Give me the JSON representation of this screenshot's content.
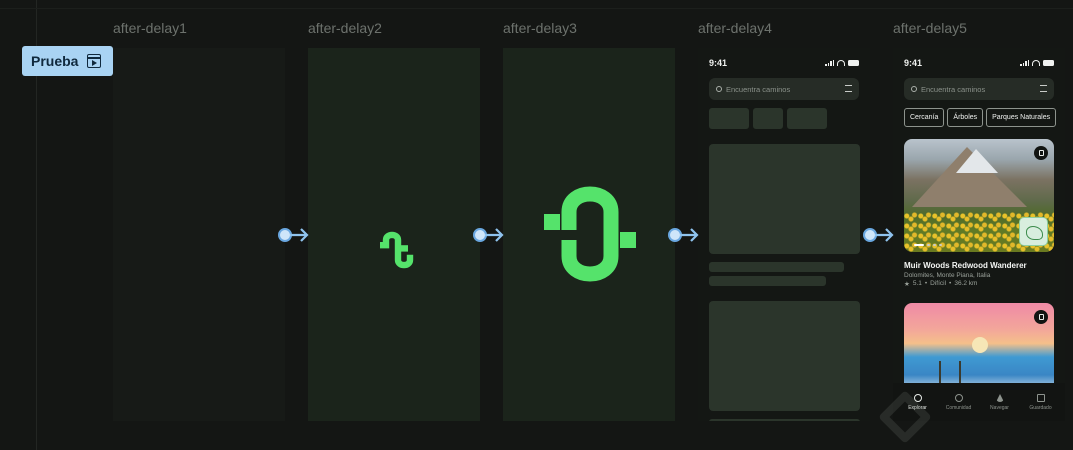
{
  "flow": {
    "name": "Prueba"
  },
  "frames": [
    {
      "label": "after-delay1"
    },
    {
      "label": "after-delay2"
    },
    {
      "label": "after-delay3"
    },
    {
      "label": "after-delay4"
    },
    {
      "label": "after-delay5"
    }
  ],
  "phone": {
    "time": "9:41",
    "search_placeholder": "Encuentra caminos",
    "chips": [
      "Cercanía",
      "Árboles",
      "Parques Naturales"
    ],
    "card1": {
      "title": "Muir Woods Redwood Wanderer",
      "location": "Dolomites, Monte Piana, Italia",
      "rating": "5.1",
      "difficulty": "Difícil",
      "distance": "36.2 km"
    },
    "nav": [
      "Explorar",
      "Comunidad",
      "Navegar",
      "Guardado"
    ]
  },
  "colors": {
    "accent_green": "#55e36b",
    "connector_blue": "#8fc3ee",
    "badge_bg": "#a9d3f3"
  },
  "icons": [
    "play-frame-icon",
    "arrow-right-icon",
    "search-icon",
    "filter-icon",
    "bookmark-icon",
    "star-icon",
    "map-thumbnail-icon",
    "compass-icon",
    "community-icon",
    "navigate-icon",
    "saved-icon"
  ]
}
